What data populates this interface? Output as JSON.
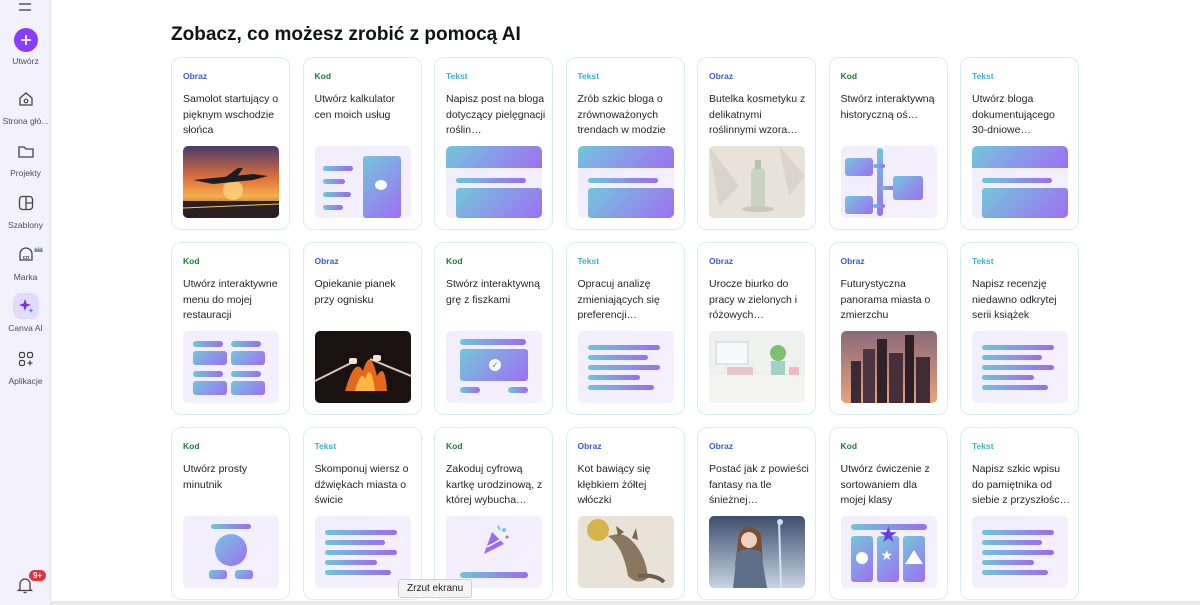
{
  "sidebar": {
    "items": [
      {
        "label": "Utwórz",
        "icon": "plus-icon"
      },
      {
        "label": "Strona głó...",
        "icon": "home-icon"
      },
      {
        "label": "Projekty",
        "icon": "folder-icon"
      },
      {
        "label": "Szablony",
        "icon": "templates-icon"
      },
      {
        "label": "Marka",
        "icon": "brand-icon"
      },
      {
        "label": "Canva AI",
        "icon": "sparkle-icon"
      },
      {
        "label": "Aplikacje",
        "icon": "apps-icon"
      }
    ],
    "notifications_badge": "9+"
  },
  "main": {
    "heading": "Zobacz, co możesz zrobić z pomocą AI"
  },
  "cards": [
    {
      "tag": "Obraz",
      "title": "Samolot startujący o pięknym wschodzie słońca",
      "thumb": "photo-plane"
    },
    {
      "tag": "Kod",
      "title": "Utwórz kalkulator cen moich usług",
      "thumb": "calc"
    },
    {
      "tag": "Tekst",
      "title": "Napisz post na bloga dotyczący pielęgnacji roślin…",
      "thumb": "doc"
    },
    {
      "tag": "Tekst",
      "title": "Zrób szkic bloga o zrównoważonych trendach w modzie",
      "thumb": "doc"
    },
    {
      "tag": "Obraz",
      "title": "Butelka kosmetyku z delikatnymi roślinnymi wzora…",
      "thumb": "photo-bottle"
    },
    {
      "tag": "Kod",
      "title": "Stwórz interaktywną historyczną oś…",
      "thumb": "timeline"
    },
    {
      "tag": "Tekst",
      "title": "Utwórz bloga dokumentującego 30-dniowe…",
      "thumb": "doc"
    },
    {
      "tag": "Kod",
      "title": "Utwórz interaktywne menu do mojej restauracji",
      "thumb": "menu"
    },
    {
      "tag": "Obraz",
      "title": "Opiekanie pianek przy ognisku",
      "thumb": "photo-fire"
    },
    {
      "tag": "Kod",
      "title": "Stwórz interaktywną grę z fiszkami",
      "thumb": "flashcard"
    },
    {
      "tag": "Tekst",
      "title": "Opracuj analizę zmieniających się preferencji…",
      "thumb": "lines"
    },
    {
      "tag": "Obraz",
      "title": "Urocze biurko do pracy w zielonych i różowych…",
      "thumb": "photo-desk"
    },
    {
      "tag": "Obraz",
      "title": "Futurystyczna panorama miasta o zmierzchu",
      "thumb": "photo-city"
    },
    {
      "tag": "Tekst",
      "title": "Napisz recenzję niedawno odkrytej serii książek",
      "thumb": "lines"
    },
    {
      "tag": "Kod",
      "title": "Utwórz prosty minutnik",
      "thumb": "timer"
    },
    {
      "tag": "Tekst",
      "title": "Skomponuj wiersz o dźwiękach miasta o świcie",
      "thumb": "lines"
    },
    {
      "tag": "Kod",
      "title": "Zakoduj cyfrową kartkę urodzinową, z której wybucha…",
      "thumb": "party"
    },
    {
      "tag": "Obraz",
      "title": "Kot bawiący się kłębkiem żółtej włóczki",
      "thumb": "photo-cat"
    },
    {
      "tag": "Obraz",
      "title": "Postać jak z powieści fantasy na tle śnieżnej…",
      "thumb": "photo-fantasy"
    },
    {
      "tag": "Kod",
      "title": "Utwórz ćwiczenie z sortowaniem dla mojej klasy",
      "thumb": "sorting"
    },
    {
      "tag": "Tekst",
      "title": "Napisz szkic wpisu do pamiętnika od siebie z przyszłośc…",
      "thumb": "lines"
    }
  ],
  "tooltip": "Zrzut ekranu",
  "colors": {
    "accent": "#8b3dff",
    "obraz": "#3c5acc",
    "kod": "#1f7a3c",
    "tekst": "#3bb3c4"
  }
}
